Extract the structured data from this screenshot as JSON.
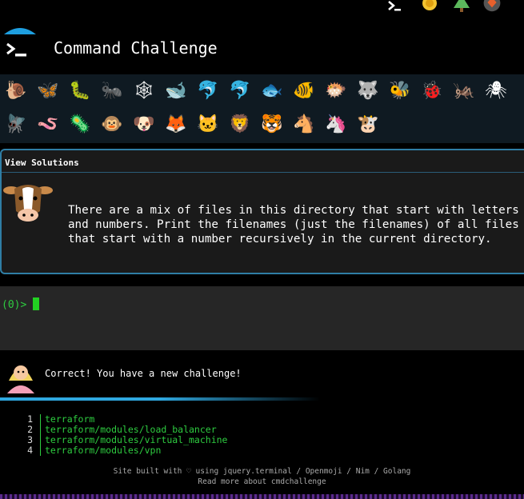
{
  "header": {
    "title": "Command Challenge"
  },
  "emoji_rows": [
    [
      "🐌",
      "🦋",
      "🐛",
      "🐜",
      "🕸",
      "🐋",
      "🐬",
      "🐬",
      "🐟",
      "🐠",
      "🐡",
      "🐺",
      "🐝",
      "🐞",
      "🦗",
      "🕷"
    ],
    [
      "🪰",
      "🪱",
      "🦠",
      "🐵",
      "🐶",
      "🦊",
      "🐱",
      "🦁",
      "🐯",
      "🐴",
      "🦄",
      "🐮"
    ]
  ],
  "panel": {
    "view_solutions": "View Solutions",
    "challenge_text": "There are a mix of files in this directory that start with letters\nand numbers. Print the filenames (just the filenames) of all files\nthat start with a number recursively in the current directory."
  },
  "terminal": {
    "prompt": "(0)>"
  },
  "feedback": {
    "message": "Correct! You have a new challenge!"
  },
  "output_lines": [
    {
      "no": "1",
      "text": "terraform"
    },
    {
      "no": "2",
      "text": "terraform/modules/load_balancer"
    },
    {
      "no": "3",
      "text": "terraform/modules/virtual_machine"
    },
    {
      "no": "4",
      "text": "terraform/modules/vpn"
    }
  ],
  "footer": {
    "line1": "Site built with ♡ using jquery.terminal / Openmoji / Nim / Golang",
    "line2": "Read more about cmdchallenge"
  },
  "colors": {
    "accent": "#2f7ea5",
    "terminal_green": "#2ecc40",
    "panel_bg": "#1a1a1a"
  }
}
